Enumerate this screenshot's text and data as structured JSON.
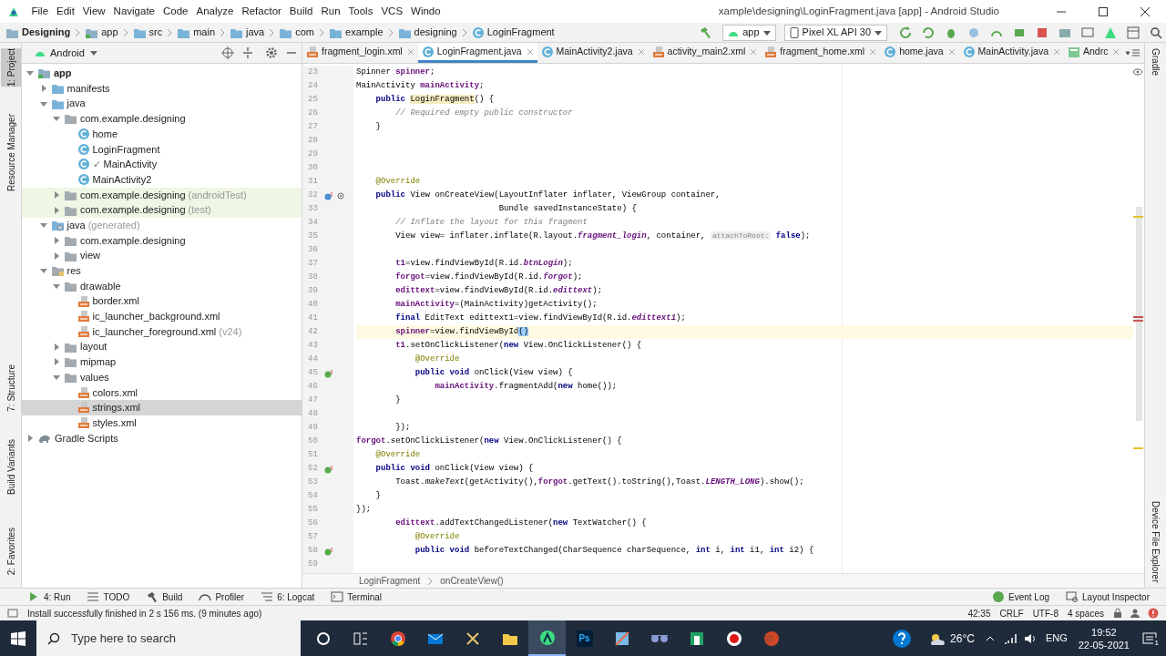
{
  "title_bar": {
    "menu": [
      "File",
      "Edit",
      "View",
      "Navigate",
      "Code",
      "Analyze",
      "Refactor",
      "Build",
      "Run",
      "Tools",
      "VCS",
      "Windo"
    ],
    "title": "xample\\designing\\LoginFragment.java [app] - Android Studio"
  },
  "nav_bar": {
    "breadcrumbs": [
      {
        "label": "Designing",
        "kind": "project"
      },
      {
        "label": "app",
        "kind": "module"
      },
      {
        "label": "src",
        "kind": "folder"
      },
      {
        "label": "main",
        "kind": "folder"
      },
      {
        "label": "java",
        "kind": "folder"
      },
      {
        "label": "com",
        "kind": "folder"
      },
      {
        "label": "example",
        "kind": "folder"
      },
      {
        "label": "designing",
        "kind": "folder"
      },
      {
        "label": "LoginFragment",
        "kind": "class"
      }
    ],
    "run_config": "app",
    "device": "Pixel XL API 30"
  },
  "left_stripe": [
    {
      "label": "1: Project",
      "selected": true
    },
    {
      "label": "Resource Manager",
      "selected": false
    },
    {
      "label": "7: Structure",
      "selected": false
    },
    {
      "label": "Build Variants",
      "selected": false
    },
    {
      "label": "2: Favorites",
      "selected": false
    }
  ],
  "right_stripe": [
    "Gradle",
    "Device File Explorer"
  ],
  "project": {
    "view": "Android",
    "tree": [
      {
        "label": "app",
        "kind": "module",
        "expanded": true,
        "selected": false,
        "tinted": false,
        "children": [
          {
            "label": "manifests",
            "kind": "folder",
            "expanded": false,
            "selected": false,
            "tinted": false
          },
          {
            "label": "java",
            "kind": "folder",
            "expanded": true,
            "selected": false,
            "tinted": false,
            "children": [
              {
                "label": "com.example.designing",
                "kind": "package",
                "expanded": true,
                "selected": false,
                "tinted": false,
                "children": [
                  {
                    "label": "home",
                    "kind": "class",
                    "selected": false,
                    "tinted": false
                  },
                  {
                    "label": "LoginFragment",
                    "kind": "class",
                    "selected": false,
                    "tinted": false
                  },
                  {
                    "label": "MainActivity",
                    "kind": "class",
                    "badge": "✓",
                    "selected": false,
                    "tinted": false
                  },
                  {
                    "label": "MainActivity2",
                    "kind": "class",
                    "selected": false,
                    "tinted": false
                  }
                ]
              },
              {
                "label": "com.example.designing",
                "note": "(androidTest)",
                "kind": "package",
                "expanded": false,
                "selected": false,
                "tinted": true
              },
              {
                "label": "com.example.designing",
                "note": "(test)",
                "kind": "package",
                "expanded": false,
                "selected": false,
                "tinted": true
              }
            ]
          },
          {
            "label": "java",
            "note": "(generated)",
            "kind": "generated",
            "expanded": true,
            "selected": false,
            "tinted": false,
            "children": [
              {
                "label": "com.example.designing",
                "kind": "package",
                "expanded": false,
                "selected": false,
                "tinted": false
              },
              {
                "label": "view",
                "kind": "package",
                "expanded": false,
                "selected": false,
                "tinted": false
              }
            ]
          },
          {
            "label": "res",
            "kind": "res",
            "expanded": true,
            "selected": false,
            "tinted": false,
            "children": [
              {
                "label": "drawable",
                "kind": "package",
                "expanded": true,
                "selected": false,
                "tinted": false,
                "children": [
                  {
                    "label": "border.xml",
                    "kind": "xml",
                    "selected": false,
                    "tinted": false
                  },
                  {
                    "label": "ic_launcher_background.xml",
                    "kind": "xml",
                    "selected": false,
                    "tinted": false
                  },
                  {
                    "label": "ic_launcher_foreground.xml",
                    "note": "(v24)",
                    "kind": "xml",
                    "selected": false,
                    "tinted": false
                  }
                ]
              },
              {
                "label": "layout",
                "kind": "package",
                "expanded": false,
                "selected": false,
                "tinted": false
              },
              {
                "label": "mipmap",
                "kind": "package",
                "expanded": false,
                "selected": false,
                "tinted": false
              },
              {
                "label": "values",
                "kind": "package",
                "expanded": true,
                "selected": false,
                "tinted": false,
                "children": [
                  {
                    "label": "colors.xml",
                    "kind": "xml",
                    "selected": false,
                    "tinted": false
                  },
                  {
                    "label": "strings.xml",
                    "kind": "xml",
                    "selected": true,
                    "tinted": false
                  },
                  {
                    "label": "styles.xml",
                    "kind": "xml",
                    "selected": false,
                    "tinted": false
                  }
                ]
              }
            ]
          }
        ]
      },
      {
        "label": "Gradle Scripts",
        "kind": "gradle",
        "expanded": false,
        "selected": false,
        "tinted": false
      }
    ]
  },
  "editor": {
    "tabs": [
      {
        "label": "fragment_login.xml",
        "kind": "xml",
        "selected": false
      },
      {
        "label": "LoginFragment.java",
        "kind": "class",
        "selected": true
      },
      {
        "label": "MainActivity2.java",
        "kind": "class",
        "selected": false
      },
      {
        "label": "activity_main2.xml",
        "kind": "xml",
        "selected": false
      },
      {
        "label": "fragment_home.xml",
        "kind": "xml",
        "selected": false
      },
      {
        "label": "home.java",
        "kind": "class",
        "selected": false
      },
      {
        "label": "MainActivity.java",
        "kind": "class",
        "selected": false
      },
      {
        "label": "Andrc",
        "kind": "manifest",
        "selected": false
      }
    ],
    "lines": [
      {
        "number": "23",
        "current": false,
        "segments": [
          {
            "text": "Spinner ",
            "kind": "plain"
          },
          {
            "text": "spinner",
            "kind": "field"
          },
          {
            "text": ";",
            "kind": "plain"
          }
        ]
      },
      {
        "number": "24",
        "current": false,
        "segments": [
          {
            "text": "MainActivity ",
            "kind": "plain"
          },
          {
            "text": "mainActivity",
            "kind": "field"
          },
          {
            "text": ";",
            "kind": "plain"
          }
        ]
      },
      {
        "number": "25",
        "current": false,
        "segments": [
          {
            "text": "    public ",
            "kind": "keyword"
          },
          {
            "text": "LoginFragment",
            "kind": "usage"
          },
          {
            "text": "() {",
            "kind": "plain"
          }
        ]
      },
      {
        "number": "26",
        "current": false,
        "segments": [
          {
            "text": "        // Required empty public constructor",
            "kind": "comment"
          }
        ]
      },
      {
        "number": "27",
        "current": false,
        "segments": [
          {
            "text": "    }",
            "kind": "plain"
          }
        ]
      },
      {
        "number": "28",
        "current": false
      },
      {
        "number": "29",
        "current": false
      },
      {
        "number": "30",
        "current": false
      },
      {
        "number": "31",
        "current": false,
        "segments": [
          {
            "text": "    @Override",
            "kind": "annotation"
          }
        ]
      },
      {
        "number": "32",
        "current": false,
        "kind": "override-at",
        "segments": [
          {
            "text": "    public",
            "kind": "keyword"
          },
          {
            "text": " View onCreateView(LayoutInflater inflater, ViewGroup container,",
            "kind": "plain"
          }
        ]
      },
      {
        "number": "33",
        "current": false,
        "segments": [
          {
            "text": "                             Bundle savedInstanceState) {",
            "kind": "plain"
          }
        ]
      },
      {
        "number": "34",
        "current": false,
        "segments": [
          {
            "text": "        // Inflate the layout for this fragment",
            "kind": "comment"
          }
        ]
      },
      {
        "number": "35",
        "current": false,
        "segments": [
          {
            "text": "        View view= inflater.inflate(R.layout.",
            "kind": "plain"
          },
          {
            "text": "fragment_login",
            "kind": "static"
          },
          {
            "text": ", container, ",
            "kind": "plain"
          },
          {
            "text": "attachToRoot:",
            "kind": "hint"
          },
          {
            "text": " false",
            "kind": "keyword"
          },
          {
            "text": ");",
            "kind": "plain"
          }
        ]
      },
      {
        "number": "36",
        "current": false
      },
      {
        "number": "37",
        "current": false,
        "segments": [
          {
            "text": "        t1",
            "kind": "field"
          },
          {
            "text": "=view.findViewById(R.id.",
            "kind": "plain"
          },
          {
            "text": "btnLogin",
            "kind": "static"
          },
          {
            "text": ");",
            "kind": "plain"
          }
        ]
      },
      {
        "number": "38",
        "current": false,
        "segments": [
          {
            "text": "        forgot",
            "kind": "field"
          },
          {
            "text": "=view.findViewById(R.id.",
            "kind": "plain"
          },
          {
            "text": "forgot",
            "kind": "static"
          },
          {
            "text": ");",
            "kind": "plain"
          }
        ]
      },
      {
        "number": "39",
        "current": false,
        "segments": [
          {
            "text": "        edittext",
            "kind": "field"
          },
          {
            "text": "=view.findViewById(R.id.",
            "kind": "plain"
          },
          {
            "text": "edittext",
            "kind": "static"
          },
          {
            "text": ");",
            "kind": "plain"
          }
        ]
      },
      {
        "number": "40",
        "current": false,
        "segments": [
          {
            "text": "        mainActivity",
            "kind": "field"
          },
          {
            "text": "=(MainActivity)getActivity();",
            "kind": "plain"
          }
        ]
      },
      {
        "number": "41",
        "current": false,
        "segments": [
          {
            "text": "        final",
            "kind": "keyword"
          },
          {
            "text": " EditText edittext1=view.findViewById(R.id.",
            "kind": "plain"
          },
          {
            "text": "edittext1",
            "kind": "static"
          },
          {
            "text": ");",
            "kind": "plain"
          }
        ]
      },
      {
        "number": "42",
        "current": true,
        "segments": [
          {
            "text": "        spinner",
            "kind": "field"
          },
          {
            "text": "=view.findViewById",
            "kind": "plain"
          },
          {
            "text": "()",
            "kind": "match"
          }
        ]
      },
      {
        "number": "43",
        "current": false,
        "segments": [
          {
            "text": "        t1",
            "kind": "field"
          },
          {
            "text": ".setOnClickListener(",
            "kind": "plain"
          },
          {
            "text": "new",
            "kind": "keyword"
          },
          {
            "text": " View.OnClickListener() {",
            "kind": "plain"
          }
        ]
      },
      {
        "number": "44",
        "current": false,
        "segments": [
          {
            "text": "            @Override",
            "kind": "annotation"
          }
        ]
      },
      {
        "number": "45",
        "current": false,
        "kind": "override",
        "segments": [
          {
            "text": "            public void",
            "kind": "keyword"
          },
          {
            "text": " onClick(View view) {",
            "kind": "plain"
          }
        ]
      },
      {
        "number": "46",
        "current": false,
        "segments": [
          {
            "text": "                mainActivity",
            "kind": "field"
          },
          {
            "text": ".fragmentAdd(",
            "kind": "plain"
          },
          {
            "text": "new",
            "kind": "keyword"
          },
          {
            "text": " home());",
            "kind": "plain"
          }
        ]
      },
      {
        "number": "47",
        "current": false,
        "segments": [
          {
            "text": "        }",
            "kind": "plain"
          }
        ]
      },
      {
        "number": "48",
        "current": false
      },
      {
        "number": "49",
        "current": false,
        "segments": [
          {
            "text": "        });",
            "kind": "plain"
          }
        ]
      },
      {
        "number": "50",
        "current": false,
        "segments": [
          {
            "text": "forgot",
            "kind": "field"
          },
          {
            "text": ".setOnClickListener(",
            "kind": "plain"
          },
          {
            "text": "new",
            "kind": "keyword"
          },
          {
            "text": " View.OnClickListener() {",
            "kind": "plain"
          }
        ]
      },
      {
        "number": "51",
        "current": false,
        "segments": [
          {
            "text": "    @Override",
            "kind": "annotation"
          }
        ]
      },
      {
        "number": "52",
        "current": false,
        "kind": "override",
        "segments": [
          {
            "text": "    public void",
            "kind": "keyword"
          },
          {
            "text": " onClick(View view) {",
            "kind": "plain"
          }
        ]
      },
      {
        "number": "53",
        "current": false,
        "segments": [
          {
            "text": "        Toast.",
            "kind": "plain"
          },
          {
            "text": "makeText",
            "kind": "static-method"
          },
          {
            "text": "(getActivity(),",
            "kind": "plain"
          },
          {
            "text": "forgot",
            "kind": "field"
          },
          {
            "text": ".getText().toString(),Toast.",
            "kind": "plain"
          },
          {
            "text": "LENGTH_LONG",
            "kind": "static"
          },
          {
            "text": ").show();",
            "kind": "plain"
          }
        ]
      },
      {
        "number": "54",
        "current": false,
        "segments": [
          {
            "text": "    }",
            "kind": "plain"
          }
        ]
      },
      {
        "number": "55",
        "current": false,
        "segments": [
          {
            "text": "});",
            "kind": "plain"
          }
        ]
      },
      {
        "number": "56",
        "current": false,
        "segments": [
          {
            "text": "        edittext",
            "kind": "field"
          },
          {
            "text": ".addTextChangedListener(",
            "kind": "plain"
          },
          {
            "text": "new",
            "kind": "keyword"
          },
          {
            "text": " TextWatcher() {",
            "kind": "plain"
          }
        ]
      },
      {
        "number": "57",
        "current": false,
        "segments": [
          {
            "text": "            @Override",
            "kind": "annotation"
          }
        ]
      },
      {
        "number": "58",
        "current": false,
        "kind": "override",
        "segments": [
          {
            "text": "            public void",
            "kind": "keyword"
          },
          {
            "text": " beforeTextChanged(CharSequence charSequence, ",
            "kind": "plain"
          },
          {
            "text": "int",
            "kind": "keyword"
          },
          {
            "text": " i, ",
            "kind": "plain"
          },
          {
            "text": "int",
            "kind": "keyword"
          },
          {
            "text": " i1, ",
            "kind": "plain"
          },
          {
            "text": "int",
            "kind": "keyword"
          },
          {
            "text": " i2) {",
            "kind": "plain"
          }
        ]
      },
      {
        "number": "59",
        "current": false
      }
    ],
    "breadcrumbs": [
      "LoginFragment",
      "onCreateView()"
    ]
  },
  "tool_windows": {
    "left": [
      {
        "label": "4: Run",
        "kind": "run"
      },
      {
        "label": "TODO",
        "kind": "todo"
      },
      {
        "label": "Build",
        "kind": "build"
      },
      {
        "label": "Profiler",
        "kind": "profiler"
      },
      {
        "label": "6: Logcat",
        "kind": "logcat"
      },
      {
        "label": "Terminal",
        "kind": "terminal"
      }
    ],
    "right": [
      {
        "label": "Event Log",
        "kind": "event"
      },
      {
        "label": "Layout Inspector",
        "kind": "inspector"
      }
    ]
  },
  "status_bar": {
    "message": "Install successfully finished in 2 s 156 ms. (9 minutes ago)",
    "position": "42:35",
    "line_separator": "CRLF",
    "encoding": "UTF-8",
    "indent": "4 spaces"
  },
  "taskbar": {
    "search_placeholder": "Type here to search",
    "apps": [
      {
        "kind": "cortana",
        "active": false
      },
      {
        "kind": "taskview",
        "active": false
      },
      {
        "kind": "chrome",
        "active": false
      },
      {
        "kind": "mail",
        "active": false
      },
      {
        "kind": "tool",
        "active": false
      },
      {
        "kind": "explorer",
        "active": false
      },
      {
        "kind": "studio",
        "active": true
      },
      {
        "kind": "photoshop",
        "label": "Ps",
        "active": false
      },
      {
        "kind": "paint",
        "active": false
      },
      {
        "kind": "glasses",
        "active": false
      },
      {
        "kind": "greenapp",
        "active": false
      },
      {
        "kind": "record",
        "active": false
      },
      {
        "kind": "powerpoint",
        "active": false
      }
    ],
    "temperature": "26°C",
    "language": "ENG",
    "time": "19:52",
    "date": "22-05-2021",
    "notifications": "1"
  }
}
